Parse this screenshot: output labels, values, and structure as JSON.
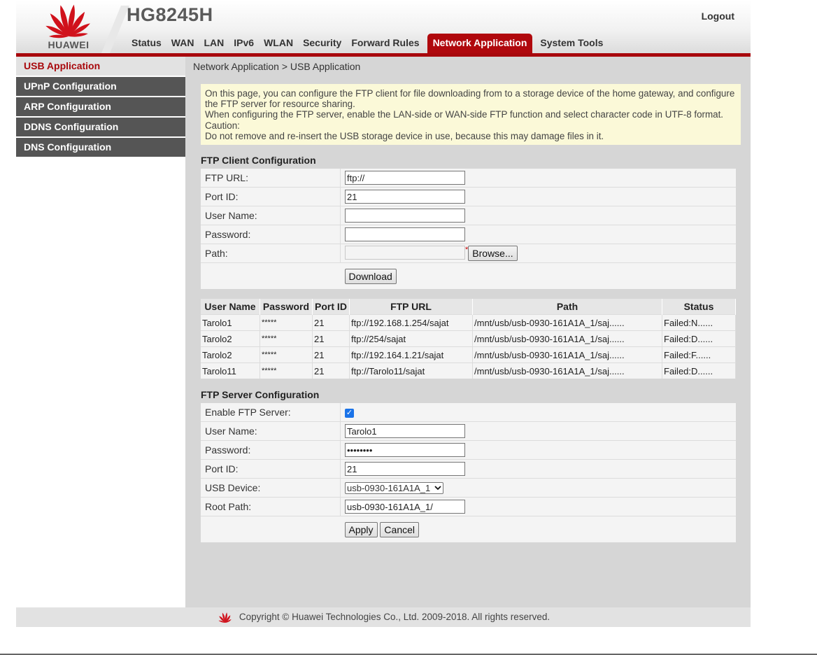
{
  "header": {
    "brand": "HUAWEI",
    "model": "HG8245H",
    "logout": "Logout",
    "tabs": [
      {
        "label": "Status"
      },
      {
        "label": "WAN"
      },
      {
        "label": "LAN"
      },
      {
        "label": "IPv6"
      },
      {
        "label": "WLAN"
      },
      {
        "label": "Security"
      },
      {
        "label": "Forward Rules"
      },
      {
        "label": "Network Application",
        "active": true
      },
      {
        "label": "System Tools"
      }
    ]
  },
  "sidebar": {
    "items": [
      {
        "label": "USB Application",
        "active": true
      },
      {
        "label": "UPnP Configuration"
      },
      {
        "label": "ARP Configuration"
      },
      {
        "label": "DDNS Configuration"
      },
      {
        "label": "DNS Configuration"
      }
    ]
  },
  "breadcrumb": "Network Application > USB Application",
  "notice": {
    "line1": "On this page, you can configure the FTP client for file downloading from to a storage device of the home gateway, and configure the FTP server for resource sharing.",
    "line2": "When configuring the FTP server, enable the LAN-side or WAN-side FTP function and select character code in UTF-8 format.",
    "line3": "Caution:",
    "line4": "Do not remove and re-insert the USB storage device in use, because this may damage files in it."
  },
  "ftp_client": {
    "title": "FTP Client Configuration",
    "url_label": "FTP URL:",
    "url_value": "ftp://",
    "port_label": "Port ID:",
    "port_value": "21",
    "user_label": "User Name:",
    "user_value": "",
    "password_label": "Password:",
    "password_value": "",
    "path_label": "Path:",
    "path_value": "",
    "required_mark": "*",
    "browse": "Browse...",
    "download": "Download"
  },
  "downloads": {
    "headers": [
      "User Name",
      "Password",
      "Port ID",
      "FTP URL",
      "Path",
      "Status"
    ],
    "rows": [
      [
        "Tarolo1",
        "*****",
        "21",
        "ftp://192.168.1.254/sajat",
        "/mnt/usb/usb-0930-161A1A_1/saj......",
        "Failed:N......"
      ],
      [
        "Tarolo2",
        "*****",
        "21",
        "ftp://254/sajat",
        "/mnt/usb/usb-0930-161A1A_1/saj......",
        "Failed:D......"
      ],
      [
        "Tarolo2",
        "*****",
        "21",
        "ftp://192.164.1.21/sajat",
        "/mnt/usb/usb-0930-161A1A_1/saj......",
        "Failed:F......"
      ],
      [
        "Tarolo11",
        "*****",
        "21",
        "ftp://Tarolo11/sajat",
        "/mnt/usb/usb-0930-161A1A_1/saj......",
        "Failed:D......"
      ]
    ]
  },
  "ftp_server": {
    "title": "FTP Server Configuration",
    "enable_label": "Enable FTP Server:",
    "enable_checked": true,
    "user_label": "User Name:",
    "user_value": "Tarolo1",
    "password_label": "Password:",
    "password_value": "••••••••",
    "port_label": "Port ID:",
    "port_value": "21",
    "device_label": "USB Device:",
    "device_value": "usb-0930-161A1A_1",
    "root_label": "Root Path:",
    "root_value": "usb-0930-161A1A_1/",
    "apply": "Apply",
    "cancel": "Cancel"
  },
  "footer": {
    "copyright": "Copyright © Huawei Technologies Co., Ltd. 2009-2018. All rights reserved."
  },
  "colors": {
    "brand_red": "#b0080d",
    "sidebar_bg": "#555555",
    "notice_bg": "#fbf9d8",
    "checkbox_blue": "#1a73e8"
  }
}
